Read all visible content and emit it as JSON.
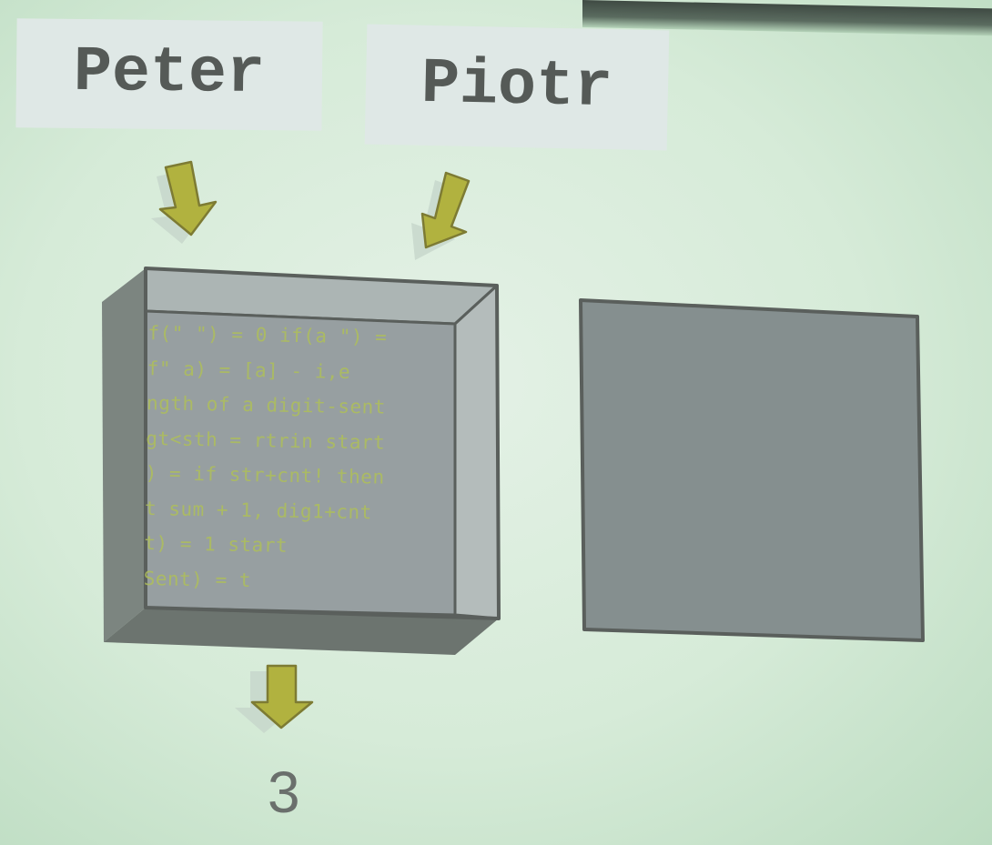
{
  "inputs": [
    {
      "name": "Peter"
    },
    {
      "name": "Piotr"
    }
  ],
  "code_box": {
    "lines": [
      "f(\" \") = 0 if(a \") =",
      "f\" a) = [a] - i,e",
      "ngth of a digit-sent",
      "gt<sth = rtrin start",
      ") = if str+cnt! then",
      "t sum + 1, dig1+cnt",
      "t) = 1 start",
      "Sent) = t"
    ]
  },
  "output": {
    "value": "3"
  },
  "colors": {
    "background": "#d6ebd8",
    "arrow": "#b1b23f",
    "box_fill": "#9aa3a1",
    "box_edge": "#5a5f5c",
    "code_text": "#aebf5a"
  }
}
